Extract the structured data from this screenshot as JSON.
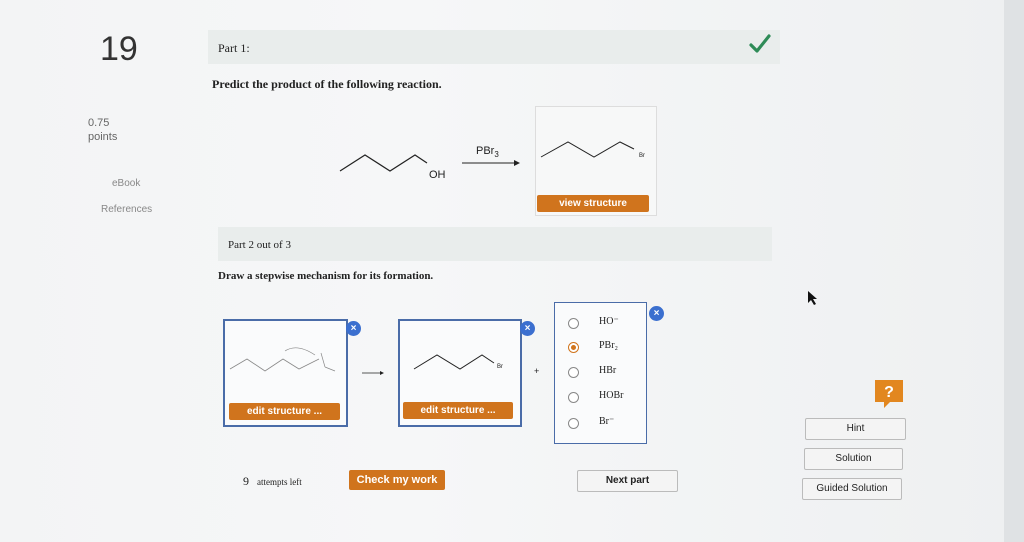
{
  "question": {
    "number": "19",
    "points_value": "0.75",
    "points_label": "points"
  },
  "sidebar": {
    "ebook": "eBook",
    "references": "References"
  },
  "part1": {
    "title": "Part 1:",
    "prompt": "Predict the product of the following reaction.",
    "reagent": "PBr3",
    "reactant_group": "OH",
    "product_label": "Br",
    "view_button": "view structure",
    "status": "correct"
  },
  "part2": {
    "title": "Part 2 out of 3",
    "prompt": "Draw a stepwise mechanism for its formation.",
    "edit_button_1": "edit structure ...",
    "edit_button_2": "edit structure ...",
    "box2_label": "Br",
    "plus": "+",
    "close_symbol": "×",
    "options": [
      "HO⁻",
      "PBr₂",
      "HBr",
      "HOBr",
      "Br⁻"
    ],
    "selected_index": 1
  },
  "footer": {
    "attempts_count": "9",
    "attempts_label": "attempts left",
    "check_button": "Check my work",
    "next_button": "Next part"
  },
  "help": {
    "hint": "Hint",
    "solution": "Solution",
    "guided": "Guided Solution",
    "icon_glyph": "?"
  },
  "colors": {
    "accent_orange": "#d0741d",
    "check_green": "#2e8b57",
    "box_blue": "#4a6ca8",
    "help_orange": "#e2871f"
  }
}
